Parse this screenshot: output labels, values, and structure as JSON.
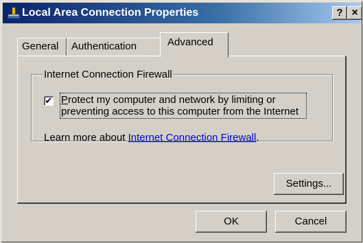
{
  "window": {
    "title": "Local Area Connection Properties",
    "help_label": "?",
    "close_label": "×"
  },
  "tabs": [
    {
      "label": "General"
    },
    {
      "label": "Authentication"
    },
    {
      "label": "Advanced"
    }
  ],
  "firewall": {
    "group_title": "Internet Connection Firewall",
    "checkbox_checked": true,
    "checkbox_mark": "✔",
    "checkbox_label_first": "P",
    "checkbox_label_rest": "rotect my computer and network by limiting or preventing access to this computer from the Internet",
    "learn_more_prefix": "Learn more about ",
    "learn_more_link": "Internet Connection Firewall",
    "learn_more_suffix": "."
  },
  "buttons": {
    "settings": "Settings...",
    "ok": "OK",
    "cancel": "Cancel"
  },
  "colors": {
    "title_bar_start": "#0a246a",
    "title_bar_end": "#a6caf0",
    "face": "#d4d0c8",
    "link": "#0000ee"
  }
}
